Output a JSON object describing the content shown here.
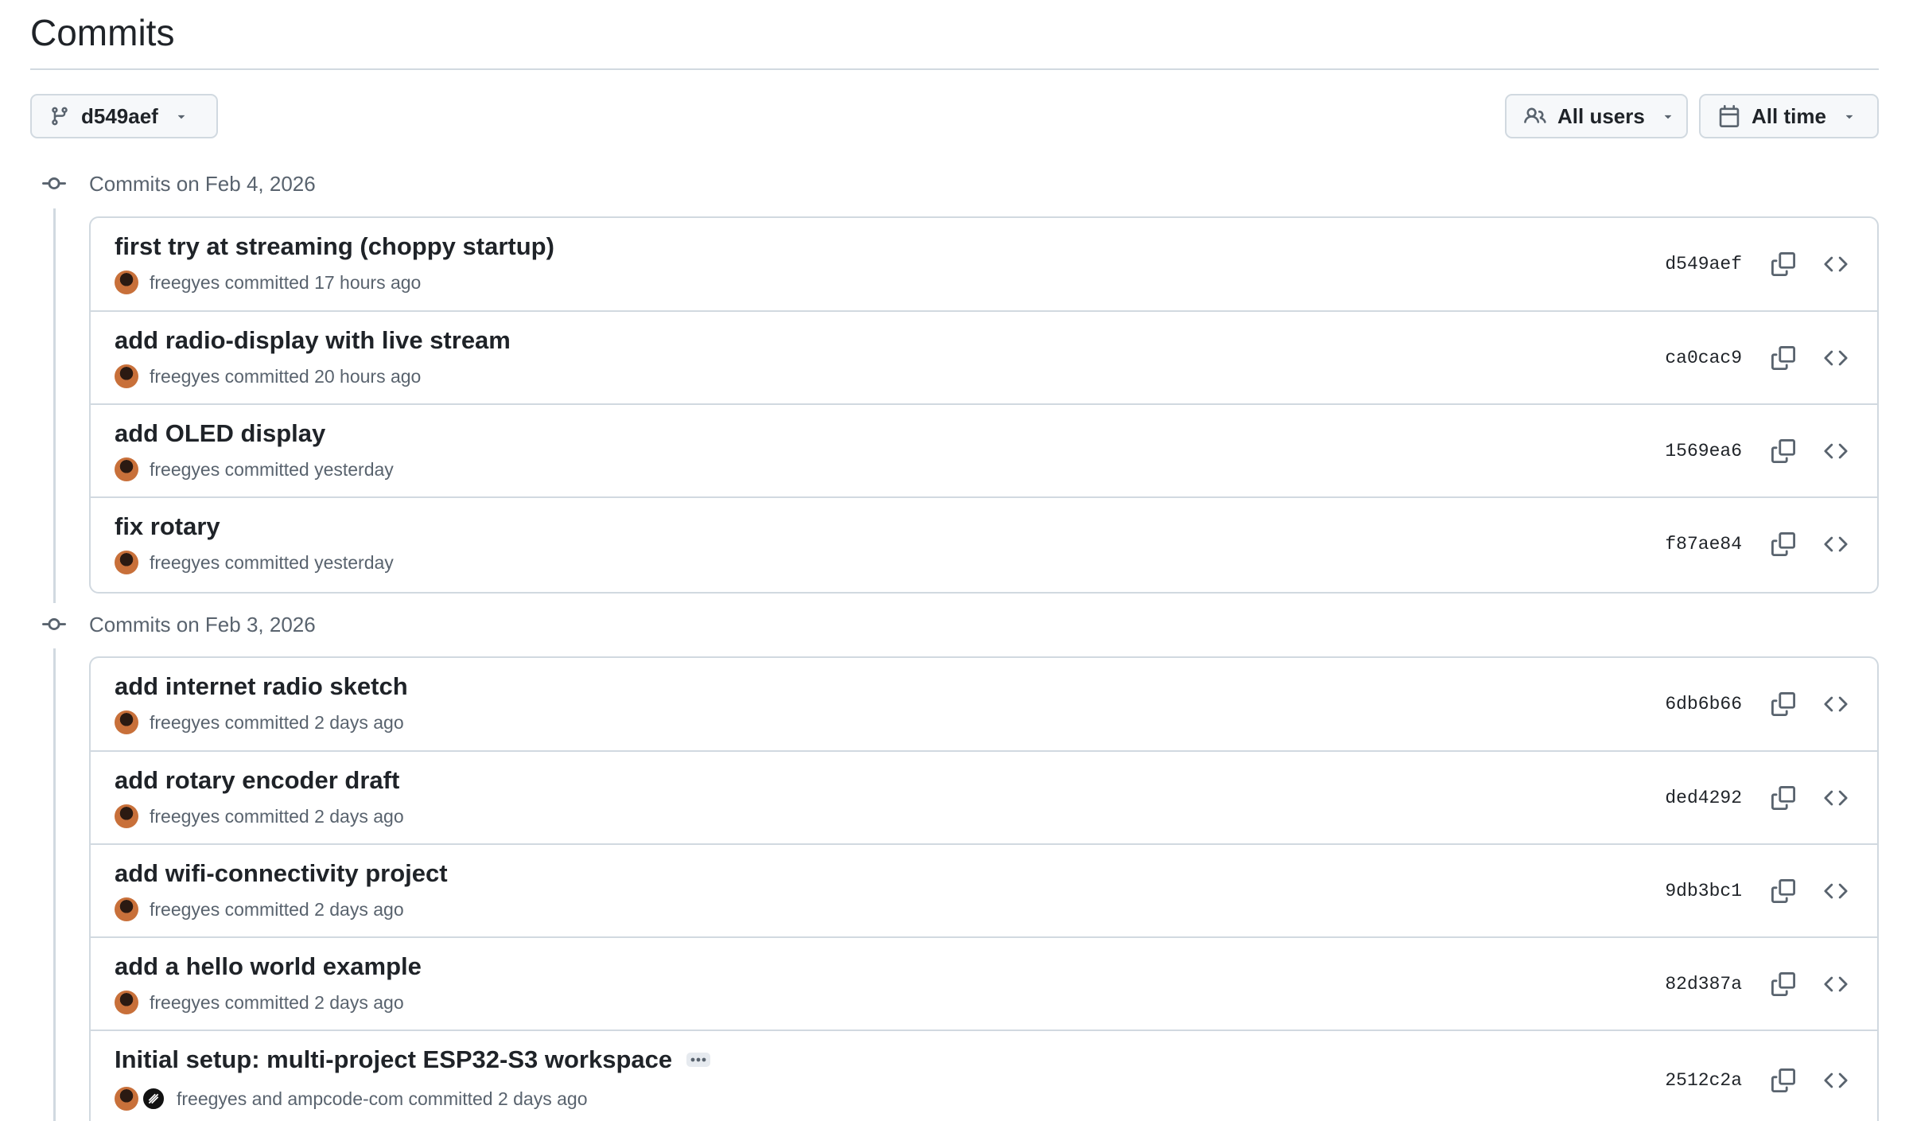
{
  "page": {
    "title": "Commits"
  },
  "filters": {
    "branch_label": "d549aef",
    "users_label": "All users",
    "time_label": "All time"
  },
  "icons": {
    "branch": "git-branch-icon",
    "users": "people-icon",
    "calendar": "calendar-icon",
    "caret": "triangle-down-icon",
    "commit": "git-commit-icon",
    "copy": "copy-icon",
    "browse": "code-icon",
    "ellipsis": "ellipsis-icon"
  },
  "colors": {
    "border": "#d1d9e0",
    "text": "#1f2328",
    "muted": "#59636e",
    "button_bg": "#f6f8fa"
  },
  "groups": [
    {
      "heading": "Commits on Feb 4, 2026",
      "commits": [
        {
          "message": "first try at streaming (choppy startup)",
          "meta": "freegyes committed 17 hours ago",
          "sha": "d549aef"
        },
        {
          "message": "add radio-display with live stream",
          "meta": "freegyes committed 20 hours ago",
          "sha": "ca0cac9"
        },
        {
          "message": "add OLED display",
          "meta": "freegyes committed yesterday",
          "sha": "1569ea6"
        },
        {
          "message": "fix rotary",
          "meta": "freegyes committed yesterday",
          "sha": "f87ae84"
        }
      ]
    },
    {
      "heading": "Commits on Feb 3, 2026",
      "commits": [
        {
          "message": "add internet radio sketch",
          "meta": "freegyes committed 2 days ago",
          "sha": "6db6b66"
        },
        {
          "message": "add rotary encoder draft",
          "meta": "freegyes committed 2 days ago",
          "sha": "ded4292"
        },
        {
          "message": "add wifi-connectivity project",
          "meta": "freegyes committed 2 days ago",
          "sha": "9db3bc1"
        },
        {
          "message": "add a hello world example",
          "meta": "freegyes committed 2 days ago",
          "sha": "82d387a"
        },
        {
          "message": "Initial setup: multi-project ESP32-S3 workspace",
          "meta": "freegyes and ampcode-com committed 2 days ago",
          "sha": "2512c2a"
        }
      ]
    }
  ]
}
